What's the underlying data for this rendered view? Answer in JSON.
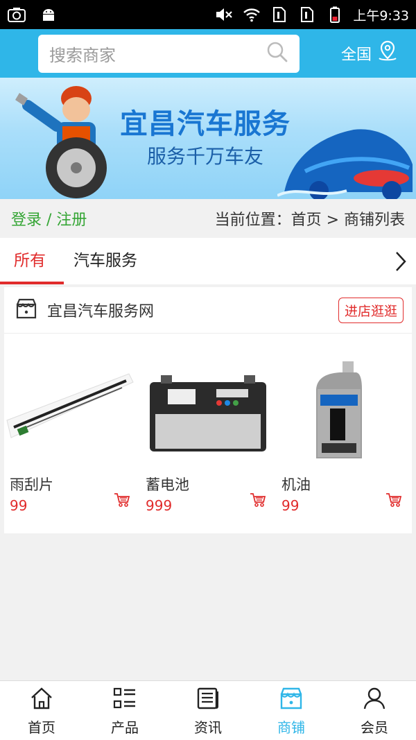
{
  "status_bar": {
    "time": "上午9:33",
    "left_icons": [
      "screenshot-icon",
      "android-icon"
    ],
    "right_icons": [
      "mute-icon",
      "wifi-icon",
      "sim1-icon",
      "sim2-icon",
      "battery-icon"
    ]
  },
  "header": {
    "search_placeholder": "搜索商家",
    "region_label": "全国",
    "accent_color": "#2fb6e8"
  },
  "banner": {
    "title": "宜昌汽车服务",
    "subtitle": "服务千万车友"
  },
  "crumbs": {
    "login_label": "登录 / 注册",
    "location_label": "当前位置：首页 > 商铺列表"
  },
  "tabs": [
    {
      "label": "所有",
      "active": true
    },
    {
      "label": "汽车服务",
      "active": false
    }
  ],
  "shop": {
    "name": "宜昌汽车服务网",
    "visit_label": "进店逛逛",
    "products": [
      {
        "name": "雨刮片",
        "price": "99",
        "image": "wiper-blade"
      },
      {
        "name": "蓄电池",
        "price": "999",
        "image": "car-battery"
      },
      {
        "name": "机油",
        "price": "99",
        "image": "motor-oil"
      }
    ]
  },
  "bottom_nav": [
    {
      "label": "首页",
      "icon": "home-icon",
      "active": false
    },
    {
      "label": "产品",
      "icon": "list-icon",
      "active": false
    },
    {
      "label": "资讯",
      "icon": "news-icon",
      "active": false
    },
    {
      "label": "商铺",
      "icon": "shop-icon",
      "active": true
    },
    {
      "label": "会员",
      "icon": "user-icon",
      "active": false
    }
  ],
  "colors": {
    "accent": "#2fb6e8",
    "price_red": "#e12c2c",
    "login_green": "#34a534"
  }
}
